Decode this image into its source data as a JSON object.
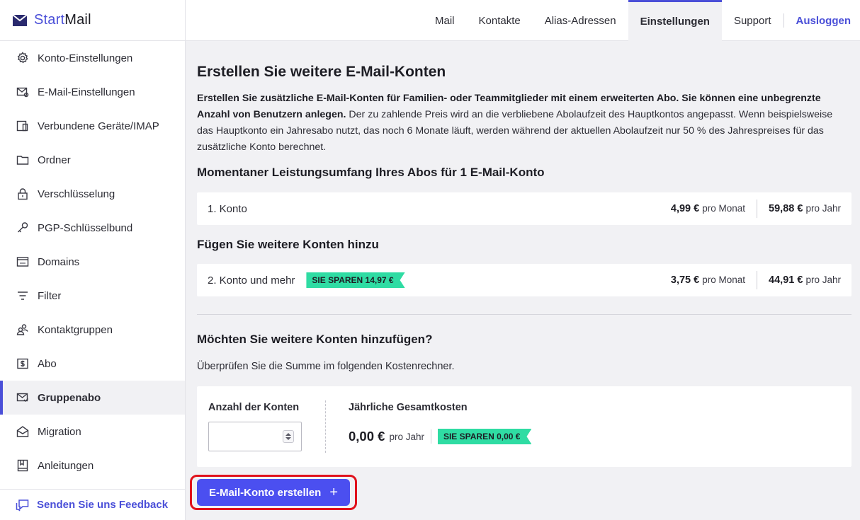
{
  "app": {
    "name_part1": "Start",
    "name_part2": "Mail"
  },
  "topnav": {
    "tabs": [
      {
        "label": "Mail"
      },
      {
        "label": "Kontakte"
      },
      {
        "label": "Alias-Adressen"
      },
      {
        "label": "Einstellungen"
      },
      {
        "label": "Support"
      }
    ],
    "logout": "Ausloggen"
  },
  "sidebar": {
    "items": [
      {
        "label": "Konto-Einstellungen"
      },
      {
        "label": "E-Mail-Einstellungen"
      },
      {
        "label": "Verbundene Geräte/IMAP"
      },
      {
        "label": "Ordner"
      },
      {
        "label": "Verschlüsselung"
      },
      {
        "label": "PGP-Schlüsselbund"
      },
      {
        "label": "Domains"
      },
      {
        "label": "Filter"
      },
      {
        "label": "Kontaktgruppen"
      },
      {
        "label": "Abo"
      },
      {
        "label": "Gruppenabo"
      },
      {
        "label": "Migration"
      },
      {
        "label": "Anleitungen"
      }
    ],
    "feedback": "Senden Sie uns Feedback"
  },
  "main": {
    "title": "Erstellen Sie weitere E-Mail-Konten",
    "intro_bold": "Erstellen Sie zusätzliche E-Mail-Konten für Familien- oder Teammitglieder mit einem erweiterten Abo. Sie können eine unbegrenzte Anzahl von Benutzern anlegen.",
    "intro_rest": " Der zu zahlende Preis wird an die verbliebene Abolaufzeit des Hauptkontos angepasst. Wenn beispielsweise das Hauptkonto ein Jahresabo nutzt, das noch 6 Monate läuft, werden während der aktuellen Abolaufzeit nur 50 % des Jahrespreises für das zusätzliche Konto berechnet.",
    "current_heading": "Momentaner Leistungsumfang Ihres Abos für 1 E-Mail-Konto",
    "current_row": {
      "label": "1. Konto",
      "monthly": "4,99 €",
      "monthly_unit": "pro Monat",
      "yearly": "59,88 €",
      "yearly_unit": "pro Jahr"
    },
    "add_heading": "Fügen Sie weitere Konten hinzu",
    "add_row": {
      "label": "2. Konto und mehr",
      "badge": "SIE SPAREN 14,97 €",
      "monthly": "3,75 €",
      "monthly_unit": "pro Monat",
      "yearly": "44,91 €",
      "yearly_unit": "pro Jahr"
    },
    "question_heading": "Möchten Sie weitere Konten hinzufügen?",
    "calc_hint": "Überprüfen Sie die Summe im folgenden Kostenrechner.",
    "calculator": {
      "count_label": "Anzahl der Konten",
      "count_value": "",
      "total_label": "Jährliche Gesamtkosten",
      "total_amount": "0,00 €",
      "total_unit": "pro Jahr",
      "badge": "SIE SPAREN 0,00 €"
    },
    "create_button": "E-Mail-Konto erstellen",
    "create_button_icon": "+"
  },
  "colors": {
    "accent": "#4a4fd8",
    "badge": "#2fdca3",
    "button": "#4b4ff0",
    "highlight": "#e0121c"
  }
}
